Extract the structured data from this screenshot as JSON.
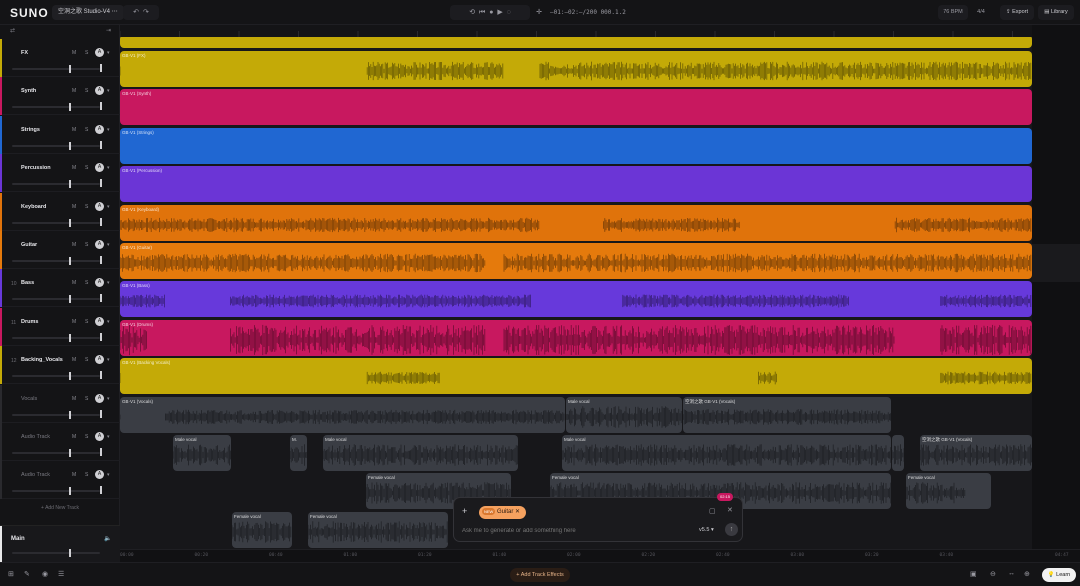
{
  "topbar": {
    "logo": "SUNO",
    "project_title": "空洞之歌 Studio-V4",
    "timecode": "–01:–02:–/200 000.1.2",
    "bpm": "76 BPM",
    "time_signature": "4/4",
    "export_label": "Export",
    "library_label": "Library"
  },
  "tracks": [
    {
      "num": "",
      "name": "FX",
      "color": "#c4aa07",
      "clip": "GB·V1 (FX)"
    },
    {
      "num": "",
      "name": "Synth",
      "color": "#c8185f",
      "clip": "GB·V1 (Synth)"
    },
    {
      "num": "",
      "name": "Strings",
      "color": "#2067d2",
      "clip": "GB·V1 (Strings)"
    },
    {
      "num": "",
      "name": "Percussion",
      "color": "#6b35d6",
      "clip": "GB·V1 (Percussion)"
    },
    {
      "num": "",
      "name": "Keyboard",
      "color": "#e0730b",
      "clip": "GB·V1 (Keyboard)"
    },
    {
      "num": "",
      "name": "Guitar",
      "color": "#e57a0c",
      "clip": "GB·V1 (Guitar)"
    },
    {
      "num": "10",
      "name": "Bass",
      "color": "#6739db",
      "clip": "GB·V1 (Bass)"
    },
    {
      "num": "11",
      "name": "Drums",
      "color": "#c8185f",
      "clip": "GB·V1 (Drums)"
    },
    {
      "num": "12",
      "name": "Backing_Vocals",
      "color": "#c4aa07",
      "clip": "GB·V1 (Backing Vocals)"
    },
    {
      "num": "",
      "name": "Vocals",
      "color": "#3a3d44",
      "clip": "GB·V1 (Vocals)"
    },
    {
      "num": "",
      "name": "Audio Track",
      "color": "#3a3d44",
      "clip": ""
    },
    {
      "num": "",
      "name": "Audio Track",
      "color": "#3a3d44",
      "clip": ""
    }
  ],
  "add_track_label": "Add New Track",
  "main_label": "Main",
  "clips": {
    "male_vocal": "Male vocal",
    "female_vocal": "Female vocal",
    "m_short": "M.",
    "vocals_alt": "空洞之歌 GB·V1 (Vocals)"
  },
  "ruler_ticks": [
    "00:00",
    "00:20",
    "00:40",
    "01:00",
    "01:20",
    "01:40",
    "02:00",
    "02:20",
    "02:40",
    "03:00",
    "03:20",
    "03:40",
    "04:47"
  ],
  "prompt": {
    "chip_badge": "NEW",
    "chip_label": "Guitar",
    "placeholder": "Ask me to generate or add something here",
    "version": "v5.5",
    "badge": "02:15"
  },
  "bottombar": {
    "add_effects_label": "Add Track Effects",
    "learn_label": "Learn"
  },
  "colors": {
    "yellow": "#c4aa07",
    "magenta": "#c8185f",
    "blue": "#2067d2",
    "purple": "#6b35d6",
    "orange": "#e0730b",
    "gray": "#3a3d44"
  }
}
